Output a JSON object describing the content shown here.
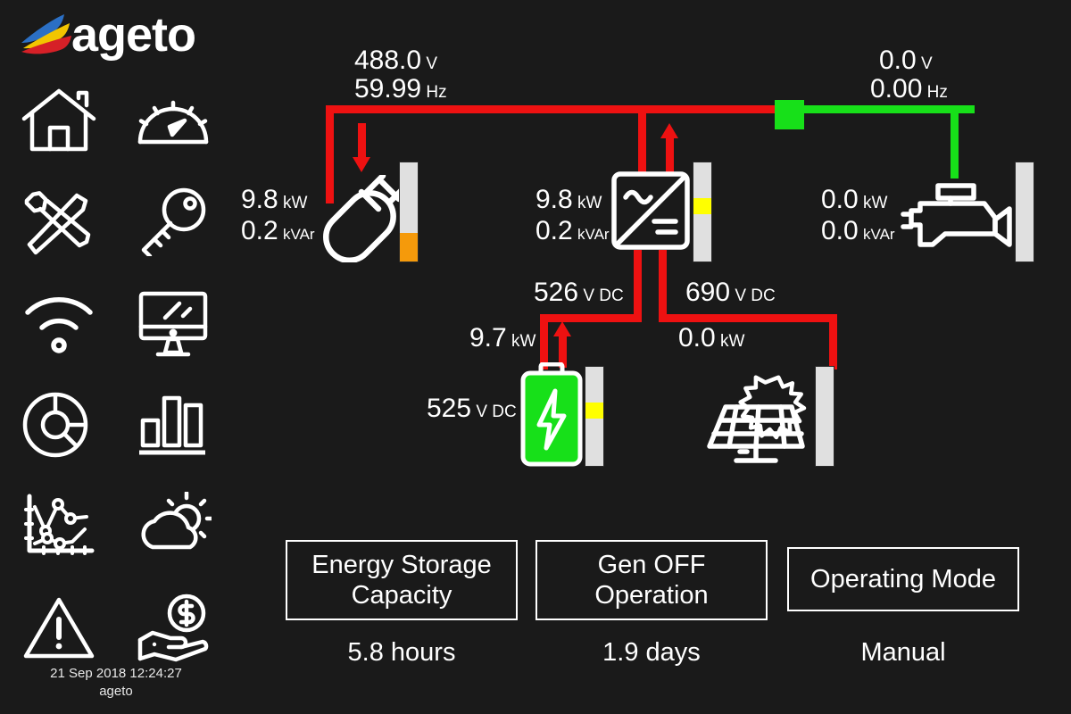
{
  "brand": {
    "name": "ageto",
    "logo_colors": [
      "#2b6fc4",
      "#f2c500",
      "#d62027"
    ]
  },
  "sidebar": {
    "items": [
      {
        "label": "Home",
        "icon": "home-icon"
      },
      {
        "label": "Gauges",
        "icon": "gauge-icon"
      },
      {
        "label": "Maintenance",
        "icon": "tools-icon"
      },
      {
        "label": "Security",
        "icon": "key-icon"
      },
      {
        "label": "Network",
        "icon": "wifi-icon"
      },
      {
        "label": "Display",
        "icon": "monitor-icon"
      },
      {
        "label": "Energy Mix",
        "icon": "pie-chart-icon"
      },
      {
        "label": "Reports",
        "icon": "bar-chart-icon"
      },
      {
        "label": "Trends",
        "icon": "line-chart-icon"
      },
      {
        "label": "Weather",
        "icon": "weather-icon"
      },
      {
        "label": "Alarms",
        "icon": "warning-icon"
      },
      {
        "label": "Savings",
        "icon": "hand-coin-icon"
      }
    ],
    "timestamp": "21 Sep 2018 12:24:27",
    "site_name": "ageto"
  },
  "diagram": {
    "ac_bus": {
      "voltage": "488.0",
      "voltage_unit": "V",
      "frequency": "59.99",
      "frequency_unit": "Hz",
      "color": "#ee1111"
    },
    "gen_bus": {
      "voltage": "0.0",
      "voltage_unit": "V",
      "frequency": "0.00",
      "frequency_unit": "Hz",
      "color": "#17e019"
    },
    "breaker": {
      "name": "gen-breaker",
      "state": "closed",
      "color": "#17e019"
    },
    "load": {
      "name": "Load",
      "icon": "plug-icon",
      "real_power": "9.8",
      "real_power_unit": "kW",
      "reactive_power": "0.2",
      "reactive_power_unit": "kVAr",
      "flow": "down",
      "bar": {
        "fill_pct": 29,
        "fill_color": "#f59a0b",
        "track_color": "#e0e0e0"
      }
    },
    "inverter": {
      "name": "Inverter",
      "icon": "inverter-icon",
      "real_power": "9.8",
      "real_power_unit": "kW",
      "reactive_power": "0.2",
      "reactive_power_unit": "kVAr",
      "flow": "up",
      "bar": {
        "marker_pos_pct": 36,
        "marker_color": "#ffff00",
        "track_color": "#e0e0e0"
      }
    },
    "generator": {
      "name": "Generator",
      "icon": "engine-icon",
      "real_power": "0.0",
      "real_power_unit": "kW",
      "reactive_power": "0.0",
      "reactive_power_unit": "kVAr",
      "bar": {
        "fill_pct": 0,
        "track_color": "#e0e0e0"
      }
    },
    "dc_left": {
      "voltage": "526",
      "voltage_unit": "V DC",
      "power": "9.7",
      "power_unit": "kW",
      "flow": "up"
    },
    "dc_right": {
      "voltage": "690",
      "voltage_unit": "V DC",
      "power": "0.0",
      "power_unit": "kW",
      "flow": "none"
    },
    "battery": {
      "name": "Battery",
      "icon": "battery-icon",
      "voltage": "525",
      "voltage_unit": "V DC",
      "color": "#17e019",
      "bar": {
        "marker_pos_pct": 36,
        "marker_color": "#ffff00",
        "track_color": "#e0e0e0"
      }
    },
    "solar": {
      "name": "Solar PV",
      "icon": "solar-panel-icon",
      "bar": {
        "fill_pct": 0,
        "track_color": "#e0e0e0"
      }
    }
  },
  "status_boxes": [
    {
      "title": "Energy Storage\nCapacity",
      "title_line1": "Energy Storage",
      "title_line2": "Capacity",
      "value": "5.8 hours"
    },
    {
      "title": "Gen OFF\nOperation",
      "title_line1": "Gen OFF",
      "title_line2": "Operation",
      "value": "1.9 days"
    },
    {
      "title": "Operating Mode",
      "title_line1": "Operating Mode",
      "title_line2": "",
      "value": "Manual"
    }
  ]
}
